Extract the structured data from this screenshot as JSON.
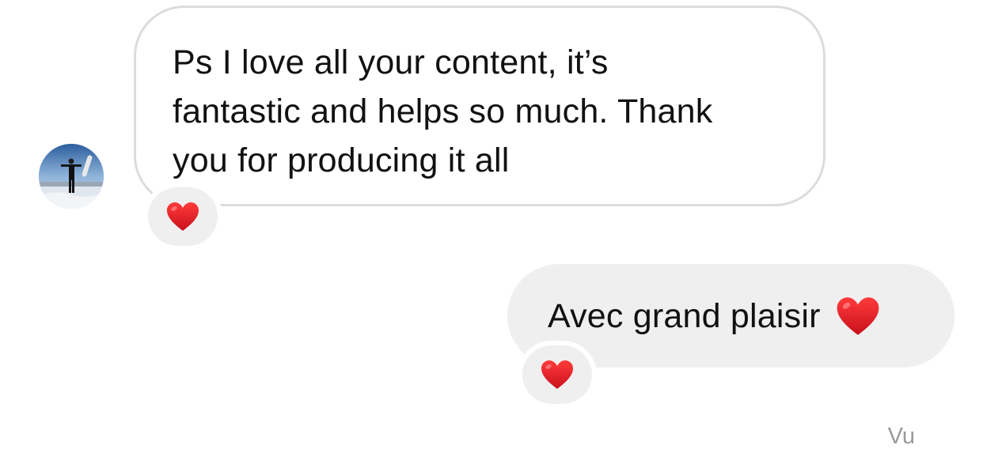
{
  "conversation": {
    "incoming": {
      "avatar_icon": "profile-avatar",
      "text": "Ps I love all your content, it’s\nfantastic and helps so much. Thank\nyou for producing it all",
      "reaction": "❤️"
    },
    "outgoing": {
      "text": "Avec grand plaisir",
      "inline_emoji": "❤️",
      "reaction": "❤️"
    },
    "status": "Vu"
  },
  "colors": {
    "incoming_border": "#dcdcdc",
    "outgoing_bg": "#efefef",
    "reaction_bg": "#efefef",
    "heart": "#e0202b",
    "status_text": "#9a9a9a"
  }
}
